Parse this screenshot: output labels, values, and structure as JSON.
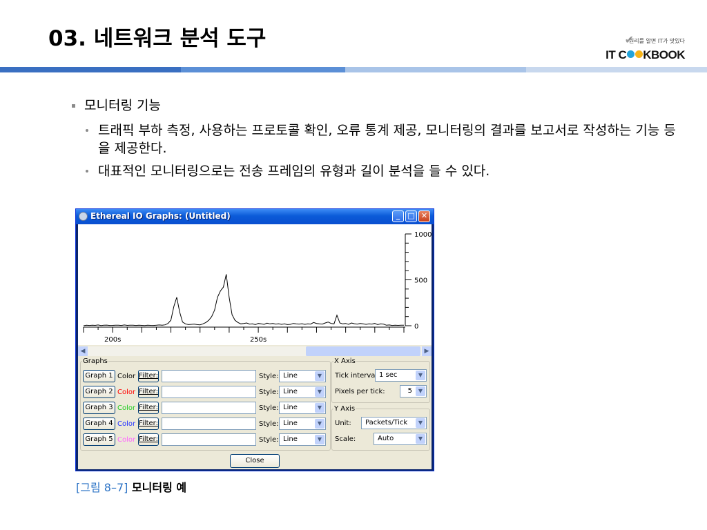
{
  "slide": {
    "title": "03. 네트워크 분석 도구",
    "brand": {
      "tagline": "원리를 알면 IT가 맛있다",
      "logo_text_1": "IT C",
      "logo_text_2": "KBOOK",
      "check_glyph": "✔",
      "dot_colors": [
        "#23a3d9",
        "#f6b419"
      ]
    },
    "band_colors": [
      "#3a6fc1",
      "#5b8fd6",
      "#a9c4e8",
      "#c8d8ee",
      "#dcdcdc"
    ]
  },
  "bullets": {
    "main": "모니터링 기능",
    "subs": [
      "트래픽 부하 측정, 사용하는 프로토콜 확인, 오류 통계 제공, 모니터링의 결과를 보고서로 작성하는 기능 등을 제공한다.",
      "대표적인 모니터링으로는 전송 프레임의 유형과 길이 분석을 들 수 있다."
    ]
  },
  "window": {
    "title": "Ethereal IO Graphs: (Untitled)",
    "controls": {
      "minimize": "_",
      "maximize": "□",
      "close": "✕"
    },
    "graphs_legend": "Graphs",
    "graphs": [
      {
        "button": "Graph 1",
        "color_label": "Color",
        "color": "#000000",
        "filter_button": "Filter:",
        "filter_value": "",
        "style_label": "Style:",
        "style_value": "Line"
      },
      {
        "button": "Graph 2",
        "color_label": "Color",
        "color": "#ff0000",
        "filter_button": "Filter:",
        "filter_value": "",
        "style_label": "Style:",
        "style_value": "Line"
      },
      {
        "button": "Graph 3",
        "color_label": "Color",
        "color": "#22cc22",
        "filter_button": "Filter:",
        "filter_value": "",
        "style_label": "Style:",
        "style_value": "Line"
      },
      {
        "button": "Graph 4",
        "color_label": "Color",
        "color": "#2233ff",
        "filter_button": "Filter:",
        "filter_value": "",
        "style_label": "Style:",
        "style_value": "Line"
      },
      {
        "button": "Graph 5",
        "color_label": "Color",
        "color": "#ff66ff",
        "filter_button": "Filter:",
        "filter_value": "",
        "style_label": "Style:",
        "style_value": "Line"
      }
    ],
    "xaxis": {
      "legend": "X Axis",
      "tick_interval_label": "Tick interval:",
      "tick_interval_value": "1 sec",
      "pixels_label": "Pixels per tick:",
      "pixels_value": "5"
    },
    "yaxis": {
      "legend": "Y Axis",
      "unit_label": "Unit:",
      "unit_value": "Packets/Tick",
      "scale_label": "Scale:",
      "scale_value": "Auto"
    },
    "close_button": "Close"
  },
  "chart_data": {
    "type": "line",
    "x": [
      190,
      191,
      192,
      193,
      194,
      195,
      196,
      197,
      198,
      199,
      200,
      201,
      202,
      203,
      204,
      205,
      206,
      207,
      208,
      209,
      210,
      211,
      212,
      213,
      214,
      215,
      216,
      217,
      218,
      219,
      220,
      221,
      222,
      223,
      224,
      225,
      226,
      227,
      228,
      229,
      230,
      231,
      232,
      233,
      234,
      235,
      236,
      237,
      238,
      239,
      240,
      241,
      242,
      243,
      244,
      245,
      246,
      247,
      248,
      249,
      250,
      251,
      252,
      253,
      254,
      255,
      256,
      257,
      258,
      259,
      260,
      261,
      262,
      263,
      264,
      265,
      266,
      267,
      268,
      269,
      270,
      271,
      272,
      273,
      274,
      275,
      276,
      277,
      278,
      279,
      280,
      281,
      282,
      283,
      284,
      285,
      286,
      287,
      288,
      289,
      290,
      291,
      292,
      293,
      294,
      295,
      296,
      297,
      298,
      299,
      300
    ],
    "series": [
      {
        "values": [
          0,
          5,
          3,
          6,
          4,
          8,
          2,
          5,
          7,
          3,
          4,
          6,
          5,
          3,
          8,
          4,
          6,
          5,
          3,
          5,
          4,
          2,
          6,
          4,
          3,
          5,
          8,
          6,
          10,
          25,
          60,
          210,
          310,
          150,
          40,
          20,
          12,
          15,
          18,
          12,
          10,
          20,
          35,
          60,
          100,
          170,
          310,
          380,
          420,
          560,
          310,
          120,
          60,
          35,
          20,
          25,
          30,
          18,
          20,
          12,
          25,
          20,
          15,
          28,
          20,
          25,
          18,
          22,
          15,
          20,
          12,
          15,
          25,
          20,
          18,
          22,
          15,
          20,
          18,
          35,
          25,
          20,
          18,
          30,
          40,
          25,
          20,
          115,
          30,
          20,
          25,
          15,
          30,
          22,
          18,
          25,
          20,
          15,
          20,
          18,
          25,
          12,
          20,
          18,
          5,
          8,
          3,
          5,
          4,
          6,
          5
        ]
      }
    ],
    "x_ticks": [
      "200s",
      "250s"
    ],
    "x_tick_values": [
      200,
      250
    ],
    "y_ticks": [
      "0",
      "500",
      "1000"
    ],
    "y_tick_values": [
      0,
      500,
      1000
    ],
    "ylim": [
      0,
      1000
    ],
    "xlim": [
      190,
      300
    ]
  },
  "caption": {
    "tag": "[그림 8–7]",
    "text": " 모니터링 예"
  }
}
